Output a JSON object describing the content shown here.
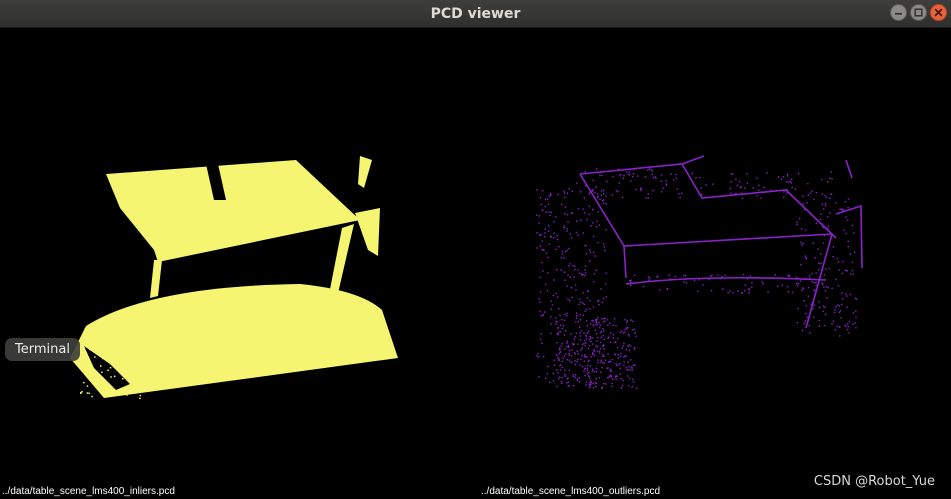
{
  "window": {
    "title": "PCD viewer",
    "controls": [
      {
        "name": "minimize",
        "icon": "minimize-icon"
      },
      {
        "name": "maximize",
        "icon": "maximize-icon"
      },
      {
        "name": "close",
        "icon": "close-icon"
      }
    ]
  },
  "viewports": [
    {
      "file_label": "../data/table_scene_lms400_inliers.pcd",
      "point_color": "#f5f571"
    },
    {
      "file_label": "../data/table_scene_lms400_outliers.pcd",
      "point_color": "#8a22c9"
    }
  ],
  "tooltip": {
    "text": "Terminal"
  },
  "watermark": {
    "text": "CSDN @Robot_Yue"
  },
  "colors": {
    "background": "#000000",
    "titlebar": "#373734",
    "title_text": "#dfdbd2",
    "close_button": "#e9623a"
  }
}
